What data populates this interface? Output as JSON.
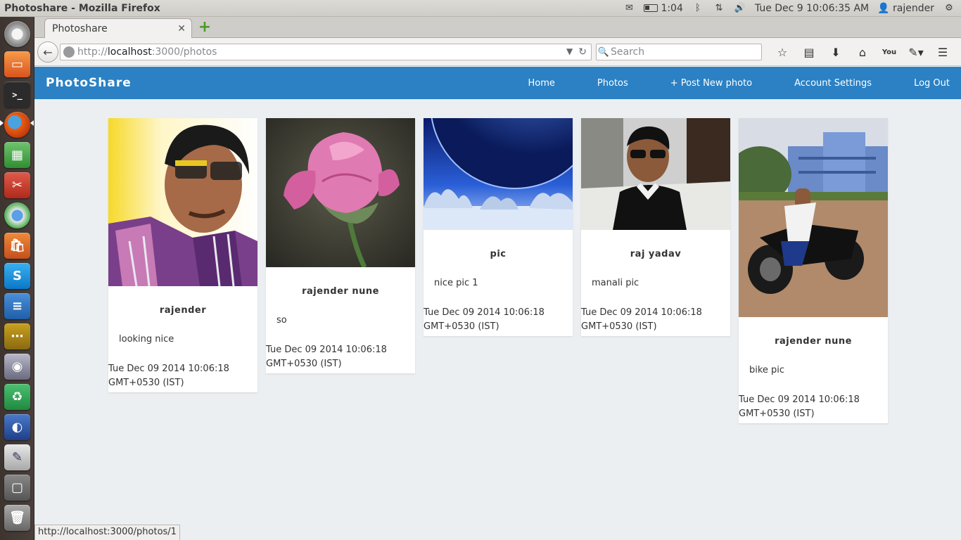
{
  "os": {
    "window_title": "Photoshare - Mozilla Firefox",
    "battery_time": "1:04",
    "clock": "Tue Dec  9 10:06:35 AM",
    "user": "rajender"
  },
  "browser": {
    "tab_title": "Photoshare",
    "url_scheme": "http://",
    "url_host": "localhost",
    "url_rest": ":3000/photos",
    "search_placeholder": "Search",
    "status_url": "http://localhost:3000/photos/1"
  },
  "app": {
    "brand": "PhotoShare",
    "nav": [
      "Home",
      "Photos",
      "+ Post New photo",
      "Account Settings",
      "Log Out"
    ]
  },
  "photos": [
    {
      "name": "rajender",
      "caption": "looking nice",
      "date_line1": "Tue Dec 09 2014 10:06:18",
      "date_line2": "GMT+0530 (IST)",
      "subject": "portrait"
    },
    {
      "name": "rajender nune",
      "caption": "so",
      "date_line1": "Tue Dec 09 2014 10:06:18",
      "date_line2": "GMT+0530 (IST)",
      "subject": "pink rose"
    },
    {
      "name": "pic",
      "caption": "nice pic 1",
      "date_line1": "Tue Dec 09 2014 10:06:18",
      "date_line2": "GMT+0530 (IST)",
      "subject": "winter night landscape"
    },
    {
      "name": "raj yadav",
      "caption": "manali pic",
      "date_line1": "Tue Dec 09 2014 10:06:18",
      "date_line2": "GMT+0530 (IST)",
      "subject": "man in sunglasses"
    },
    {
      "name": "rajender nune",
      "caption": "bike pic",
      "date_line1": "Tue Dec 09 2014 10:06:18",
      "date_line2": "GMT+0530 (IST)",
      "subject": "man on motorbike"
    }
  ],
  "colors": {
    "nav_bg": "#2b81c4",
    "page_bg": "#eceff1"
  }
}
